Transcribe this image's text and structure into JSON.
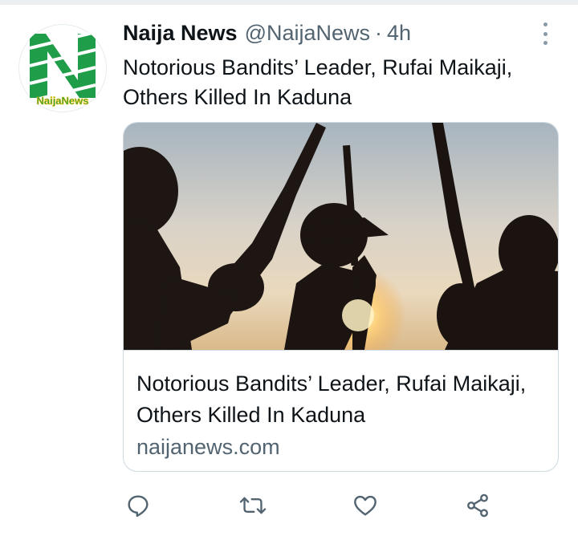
{
  "tweet": {
    "author_name": "Naija News",
    "handle": "@NaijaNews",
    "separator": "·",
    "time": "4h",
    "text": "Notorious Bandits’ Leader, Rufai Maikaji, Others Killed In Kaduna",
    "avatar_logo_text": "NaijaNews"
  },
  "card": {
    "title": "Notorious Bandits’ Leader, Rufai Maikaji, Others Killed In Kaduna",
    "domain": "naijanews.com",
    "image_description": "silhouettes-of-armed-men-against-sky"
  },
  "actions": {
    "reply_icon": "reply-icon",
    "retweet_icon": "retweet-icon",
    "like_icon": "heart-icon",
    "share_icon": "share-icon"
  },
  "colors": {
    "primary_text": "#0f1419",
    "secondary_text": "#536471",
    "icon": "#536471",
    "border": "#cfd9de",
    "brand_green": "#1f9d48"
  }
}
